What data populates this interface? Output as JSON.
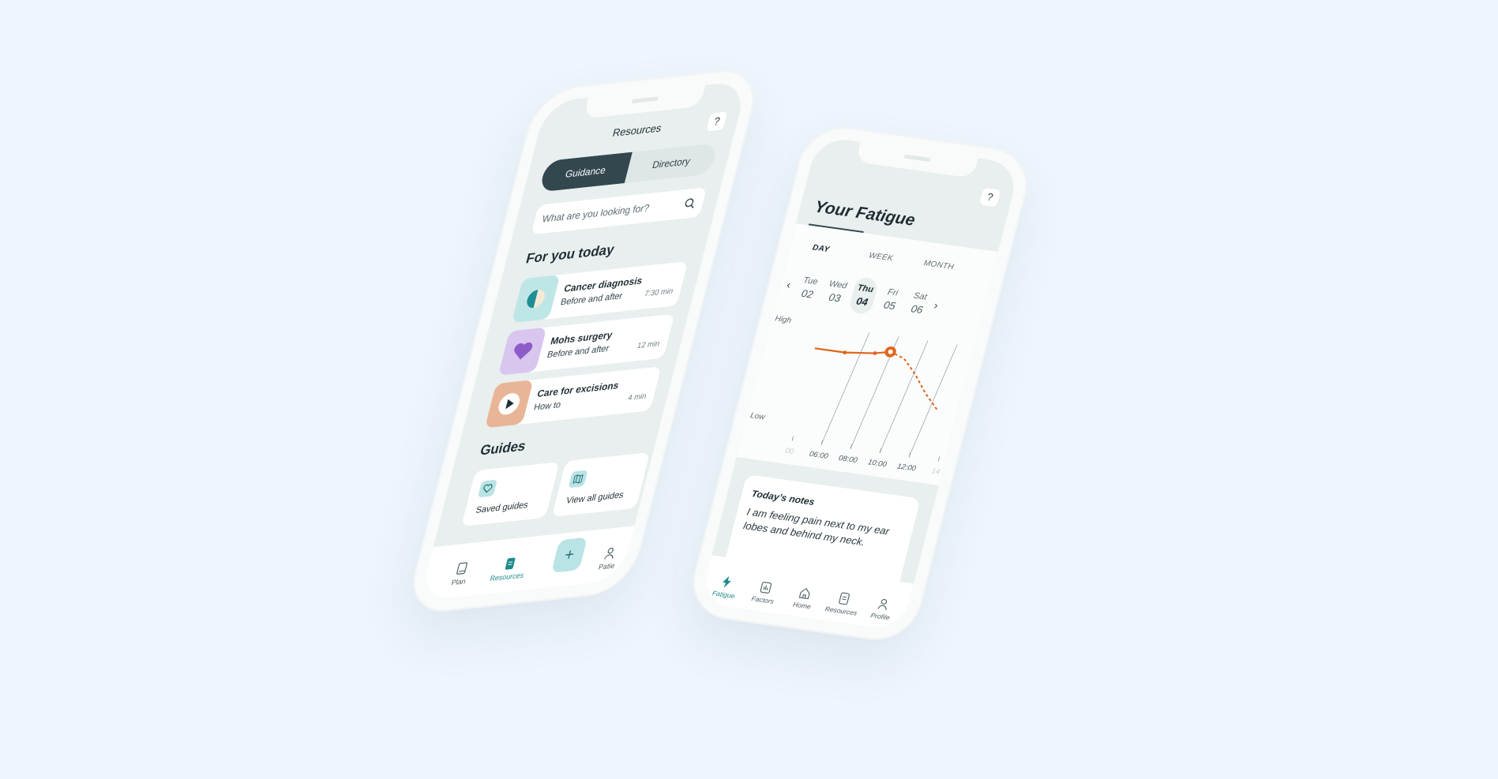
{
  "resources_screen": {
    "title": "Resources",
    "help": "?",
    "tabs": [
      {
        "label": "Guidance",
        "active": true
      },
      {
        "label": "Directory",
        "active": false
      }
    ],
    "search_placeholder": "What are you looking for?",
    "for_you_title": "For you today",
    "cards": [
      {
        "title": "Cancer diagnosis",
        "subtitle": "Before and after",
        "duration": "7:30 min",
        "icon": "half-circle-icon"
      },
      {
        "title": "Mohs surgery",
        "subtitle": "Before and after",
        "duration": "12 min",
        "icon": "heart-icon"
      },
      {
        "title": "Care for excisions",
        "subtitle": "How to",
        "duration": "4 min",
        "icon": "play-icon"
      }
    ],
    "guides_title": "Guides",
    "guides": [
      {
        "label": "Saved guides",
        "icon": "heart-outline-icon"
      },
      {
        "label": "View all guides",
        "icon": "map-icon"
      }
    ],
    "nav": [
      {
        "label": "Plan",
        "icon": "book-icon"
      },
      {
        "label": "Resources",
        "icon": "document-icon",
        "active": true
      },
      {
        "label": "+",
        "icon": "plus-icon"
      },
      {
        "label": "Patie",
        "icon": "person-icon"
      }
    ]
  },
  "fatigue_screen": {
    "help": "?",
    "title": "Your Fatigue",
    "range_tabs": [
      {
        "label": "DAY",
        "active": true
      },
      {
        "label": "WEEK",
        "active": false
      },
      {
        "label": "MONTH",
        "active": false
      }
    ],
    "prev": "‹",
    "next": "›",
    "days": [
      {
        "name": "Tue",
        "num": "02"
      },
      {
        "name": "Wed",
        "num": "03"
      },
      {
        "name": "Thu",
        "num": "04",
        "active": true
      },
      {
        "name": "Fri",
        "num": "05"
      },
      {
        "name": "Sat",
        "num": "06"
      }
    ],
    "notes_title": "Today’s notes",
    "notes_body": "I am feeling pain next to my ear lobes and behind my neck.",
    "nav": [
      {
        "label": "Fatigue",
        "icon": "bolt-icon",
        "active": true
      },
      {
        "label": "Factors",
        "icon": "bar-chart-icon"
      },
      {
        "label": "Home",
        "icon": "home-icon"
      },
      {
        "label": "Resources",
        "icon": "document-icon"
      },
      {
        "label": "Profile",
        "icon": "person-icon"
      }
    ],
    "accent_color": "#e0661c"
  },
  "chart_data": {
    "type": "line",
    "title": "",
    "xlabel": "",
    "ylabel": "",
    "y_tick_labels": [
      "High",
      "Low"
    ],
    "x_tick_labels": [
      "00",
      "06:00",
      "08:00",
      "10:00",
      "12:00",
      "14"
    ],
    "ylim": [
      0,
      10
    ],
    "series": [
      {
        "style": "solid",
        "x": [
          "04:00",
          "06:00",
          "08:00",
          "09:00"
        ],
        "y": [
          8.0,
          8.0,
          8.3,
          8.6
        ]
      },
      {
        "style": "dashed",
        "x": [
          "09:00",
          "10:00",
          "11:00",
          "12:00",
          "13:00"
        ],
        "y": [
          8.6,
          8.2,
          7.0,
          5.5,
          4.3
        ]
      }
    ],
    "highlight": {
      "x": "09:00",
      "y": 8.6
    },
    "grid": true
  }
}
